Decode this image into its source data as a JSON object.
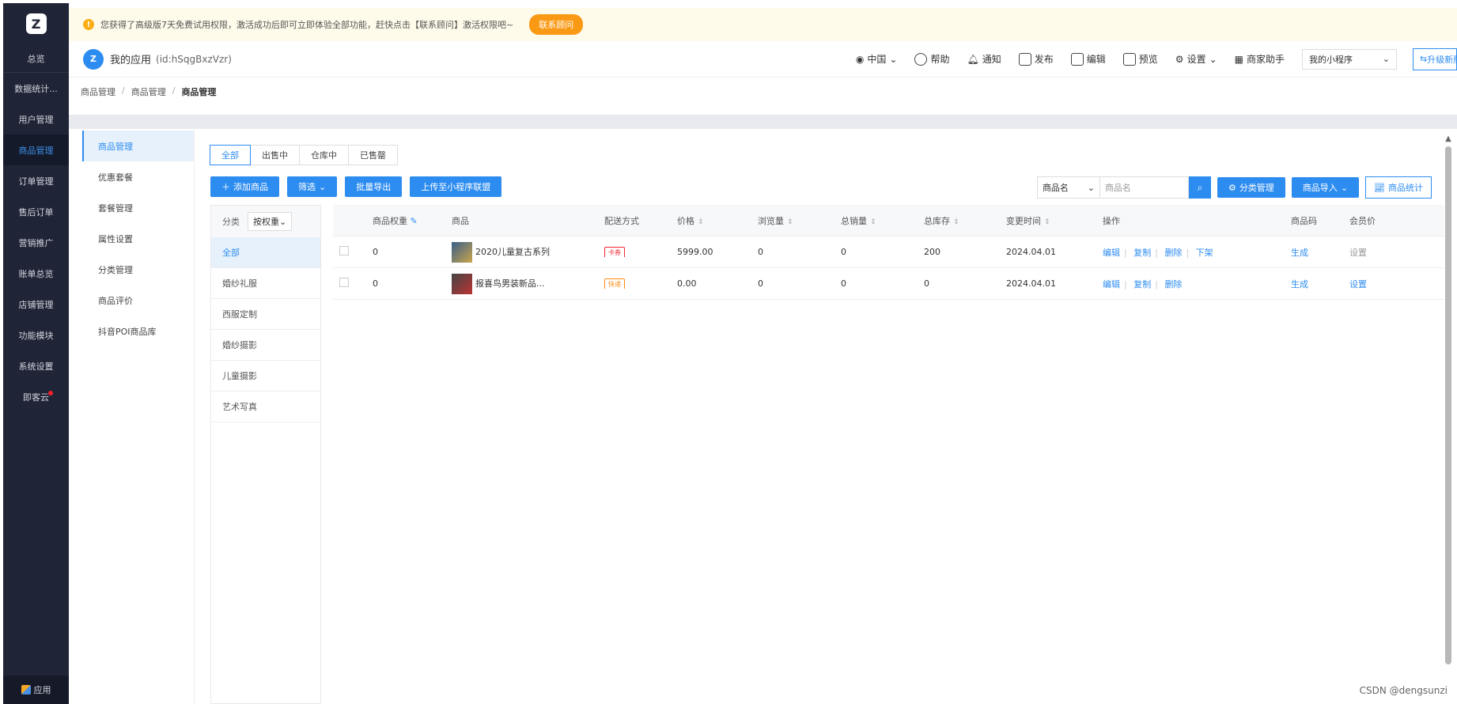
{
  "sidebar": {
    "items": [
      {
        "label": "总览"
      },
      {
        "label": "数据统计..."
      },
      {
        "label": "用户管理"
      },
      {
        "label": "商品管理"
      },
      {
        "label": "订单管理"
      },
      {
        "label": "售后订单"
      },
      {
        "label": "营销推广"
      },
      {
        "label": "账单总览"
      },
      {
        "label": "店铺管理"
      },
      {
        "label": "功能模块"
      },
      {
        "label": "系统设置"
      },
      {
        "label": "即客云"
      }
    ],
    "bottom_label": "应用"
  },
  "notice": {
    "text": "您获得了高级版7天免费试用权限，激活成功后即可立即体验全部功能，赶快点击【联系顾问】激活权限吧~",
    "button": "联系顾问"
  },
  "topbar": {
    "app_name": "我的应用",
    "app_id": "(id:hSqgBxzVzr)",
    "region": "中国",
    "help": "帮助",
    "notify": "通知",
    "publish": "发布",
    "edit": "编辑",
    "preview": "预览",
    "settings": "设置",
    "merchant": "商家助手",
    "miniapp_select": "我的小程序",
    "upgrade": "升级新版"
  },
  "breadcrumb": [
    "商品管理",
    "商品管理",
    "商品管理"
  ],
  "subnav": [
    "商品管理",
    "优惠套餐",
    "套餐管理",
    "属性设置",
    "分类管理",
    "商品评价",
    "抖音POI商品库"
  ],
  "tabs": [
    "全部",
    "出售中",
    "仓库中",
    "已售罄"
  ],
  "actions": {
    "add": "添加商品",
    "filter": "筛选",
    "export": "批量导出",
    "upload": "上传至小程序联盟"
  },
  "search": {
    "field": "商品名",
    "placeholder": "商品名",
    "category_mgmt": "分类管理",
    "import": "商品导入",
    "stats": "商品统计"
  },
  "category": {
    "label": "分类",
    "sort": "按权重",
    "items": [
      "全部",
      "婚纱礼服",
      "西服定制",
      "婚纱摄影",
      "儿童摄影",
      "艺术写真"
    ]
  },
  "table": {
    "headers": [
      "商品权重",
      "商品",
      "配送方式",
      "价格",
      "浏览量",
      "总销量",
      "总库存",
      "变更时间",
      "操作",
      "商品码",
      "会员价"
    ],
    "rows": [
      {
        "weight": "0",
        "name": "2020儿童复古系列",
        "ship": "卡券",
        "price": "5999.00",
        "views": "0",
        "sales": "0",
        "stock": "200",
        "time": "2024.04.01",
        "ops": [
          "编辑",
          "复制",
          "删除",
          "下架"
        ],
        "code": "生成",
        "member": "设置"
      },
      {
        "weight": "0",
        "name": "报喜鸟男装新品...",
        "ship": "快递",
        "price": "0.00",
        "views": "0",
        "sales": "0",
        "stock": "0",
        "time": "2024.04.01",
        "ops": [
          "编辑",
          "复制",
          "删除"
        ],
        "code": "生成",
        "member": "设置"
      }
    ]
  },
  "watermark": "CSDN @dengsunzi"
}
